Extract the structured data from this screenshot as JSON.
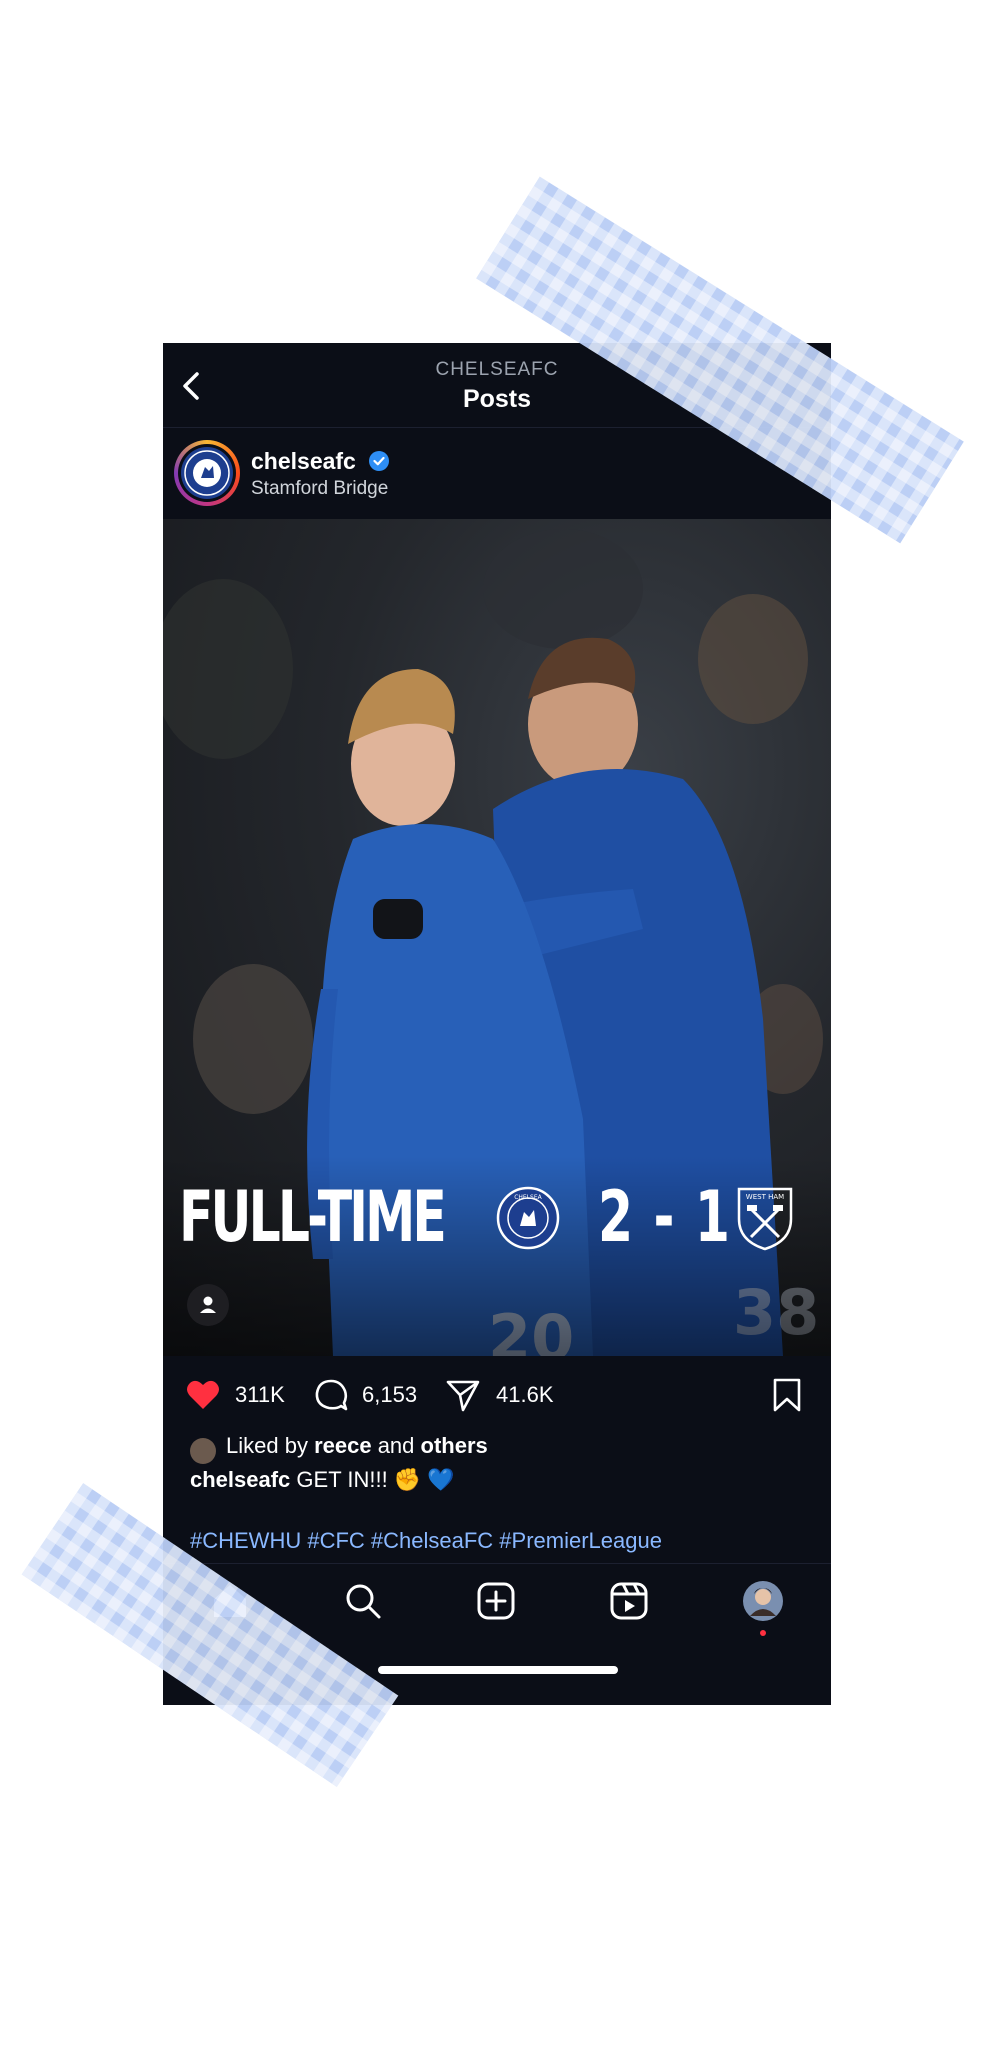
{
  "header": {
    "subtitle": "CHELSEAFC",
    "title": "Posts"
  },
  "post": {
    "username": "chelseafc",
    "location": "Stamford Bridge",
    "overlay": {
      "status": "FULL-TIME",
      "score": "2 - 1",
      "home_team": "CHELSEA",
      "away_team": "WEST HAM"
    },
    "likes": "311K",
    "comments": "6,153",
    "shares": "41.6K",
    "liked_by_prefix": "Liked by ",
    "liked_by_user": "reece",
    "liked_by_mid": " and ",
    "liked_by_others": "others",
    "caption_user": "chelseafc",
    "caption_text": " GET IN!!! ✊ 💙",
    "hashtags": "#CHEWHU #CFC #ChelseaFC #PremierLeague"
  },
  "colors": {
    "background": "#0b0e17",
    "like_red": "#ff3040",
    "hashtag": "#8ab8ff",
    "verified": "#2e8ef5",
    "tape": "#b9cdf5"
  },
  "icons": [
    "back-icon",
    "verified-icon",
    "heart-icon",
    "comment-icon",
    "share-icon",
    "bookmark-icon",
    "home-icon",
    "search-icon",
    "create-icon",
    "reels-icon",
    "profile-icon"
  ]
}
